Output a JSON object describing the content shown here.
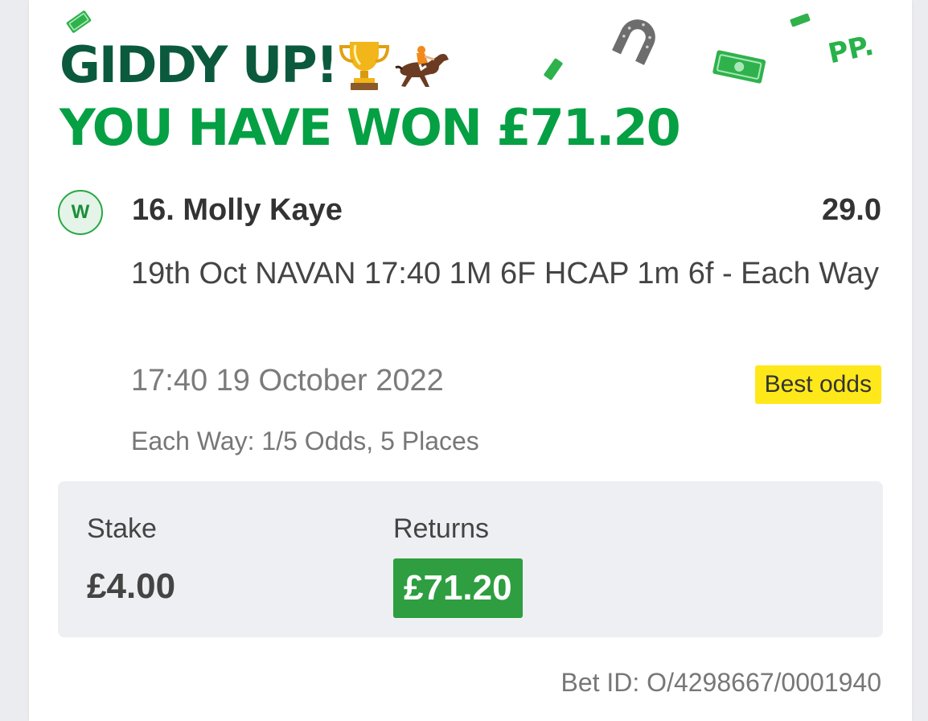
{
  "banner": {
    "line1": "GIDDY UP!",
    "line2": "YOU HAVE WON £71.20",
    "emojis": [
      "🏆",
      "🏇"
    ],
    "corner_text": "PP."
  },
  "bet": {
    "result_badge": "W",
    "selection": "16. Molly Kaye",
    "odds": "29.0",
    "market": "19th Oct NAVAN 17:40 1M 6F HCAP 1m 6f - Each Way",
    "event_time": "17:40 19 October 2022",
    "best_odds_label": "Best odds",
    "each_way_terms": "Each Way: 1/5 Odds, 5 Places",
    "stake_label": "Stake",
    "stake_value": "£4.00",
    "returns_label": "Returns",
    "returns_value": "£71.20",
    "bet_id": "Bet ID: O/4298667/0001940"
  },
  "colors": {
    "headline_dark": "#0b5a3e",
    "headline_green": "#05a043",
    "win_badge": "#28a745",
    "best_odds_bg": "#ffe81a",
    "returns_bg": "#2e9e40",
    "stake_box_bg": "#eeeff3"
  },
  "icons": [
    "trophy-icon",
    "horse-racing-icon",
    "horseshoe-icon",
    "money-bill-icon",
    "win-badge-icon"
  ]
}
